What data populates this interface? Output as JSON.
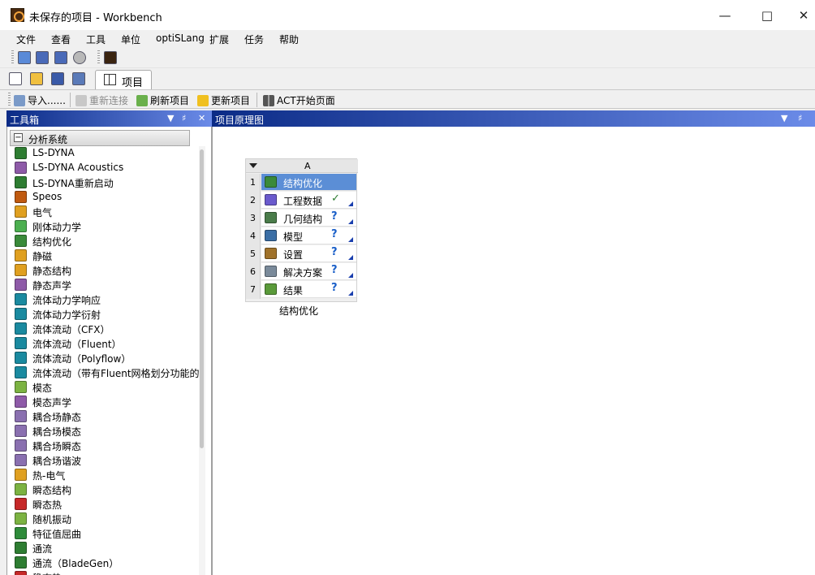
{
  "window": {
    "title": "未保存的项目 - Workbench"
  },
  "menu": [
    "文件",
    "查看",
    "工具",
    "单位",
    "optiSLang",
    "扩展",
    "任务",
    "帮助"
  ],
  "tab": {
    "label": "项目"
  },
  "toolbar": {
    "import": "导入......",
    "reconnect": "重新连接",
    "refresh": "刷新项目",
    "update": "更新项目",
    "act": "ACT开始页面"
  },
  "toolbox": {
    "title": "工具箱",
    "group": "分析系统",
    "items": [
      {
        "label": "LS-DYNA",
        "color": "#2e7d32"
      },
      {
        "label": "LS-DYNA Acoustics",
        "color": "#8e5aa8"
      },
      {
        "label": "LS-DYNA重新启动",
        "color": "#2e7d32"
      },
      {
        "label": "Speos",
        "color": "#c05a10"
      },
      {
        "label": "电气",
        "color": "#e0a020"
      },
      {
        "label": "刚体动力学",
        "color": "#4caf50"
      },
      {
        "label": "结构优化",
        "color": "#3a8a3a"
      },
      {
        "label": "静磁",
        "color": "#e0a020"
      },
      {
        "label": "静态结构",
        "color": "#e0a020"
      },
      {
        "label": "静态声学",
        "color": "#8e5aa8"
      },
      {
        "label": "流体动力学响应",
        "color": "#1a8aa0"
      },
      {
        "label": "流体动力学衍射",
        "color": "#1a8aa0"
      },
      {
        "label": "流体流动（CFX）",
        "color": "#1a8aa0"
      },
      {
        "label": "流体流动（Fluent）",
        "color": "#1a8aa0"
      },
      {
        "label": "流体流动（Polyflow）",
        "color": "#1a8aa0"
      },
      {
        "label": "流体流动（带有Fluent网格划分功能的",
        "color": "#1a8aa0"
      },
      {
        "label": "模态",
        "color": "#7cb342"
      },
      {
        "label": "模态声学",
        "color": "#8e5aa8"
      },
      {
        "label": "耦合场静态",
        "color": "#8a70b0"
      },
      {
        "label": "耦合场模态",
        "color": "#8a70b0"
      },
      {
        "label": "耦合场瞬态",
        "color": "#8a70b0"
      },
      {
        "label": "耦合场谐波",
        "color": "#8a70b0"
      },
      {
        "label": "热-电气",
        "color": "#e0a020"
      },
      {
        "label": "瞬态结构",
        "color": "#7cb342"
      },
      {
        "label": "瞬态热",
        "color": "#c62828"
      },
      {
        "label": "随机振动",
        "color": "#7cb342"
      },
      {
        "label": "特征值屈曲",
        "color": "#2e8b3a"
      },
      {
        "label": "通流",
        "color": "#2e7d32"
      },
      {
        "label": "通流（BladeGen）",
        "color": "#2e7d32"
      },
      {
        "label": "稳态热",
        "color": "#c62828"
      }
    ]
  },
  "schematic": {
    "title": "项目原理图",
    "system": {
      "column": "A",
      "caption": "结构优化",
      "rows": [
        {
          "num": "1",
          "label": "结构优化",
          "status": "",
          "color": "#3a8a3a"
        },
        {
          "num": "2",
          "label": "工程数据",
          "status": "✓",
          "color": "#6a5acd"
        },
        {
          "num": "3",
          "label": "几何结构",
          "status": "?",
          "color": "#4a7c4a"
        },
        {
          "num": "4",
          "label": "模型",
          "status": "?",
          "color": "#3a6ea5"
        },
        {
          "num": "5",
          "label": "设置",
          "status": "?",
          "color": "#a0722a"
        },
        {
          "num": "6",
          "label": "解决方案",
          "status": "?",
          "color": "#7a8a9a"
        },
        {
          "num": "7",
          "label": "结果",
          "status": "?",
          "color": "#5a9a3a"
        }
      ]
    }
  }
}
